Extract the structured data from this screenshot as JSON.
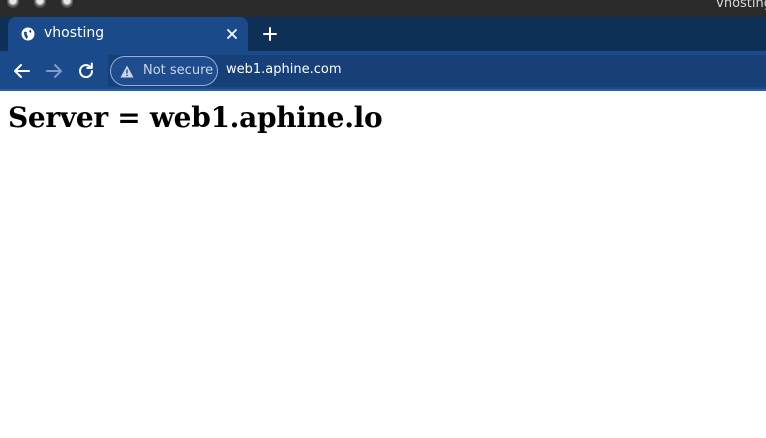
{
  "window": {
    "title": "vhosting"
  },
  "tab": {
    "title": "vhosting",
    "favicon": "globe-icon"
  },
  "toolbar": {
    "security_label": "Not secure",
    "url": "web1.aphine.com"
  },
  "page": {
    "heading": "Server = web1.aphine.lo"
  },
  "colors": {
    "titlebar": "#2b2b2b",
    "tabstrip": "#0e2f56",
    "active_tab": "#1a4a8a",
    "omnibox": "#173f78",
    "page_background": "#ffffff"
  }
}
